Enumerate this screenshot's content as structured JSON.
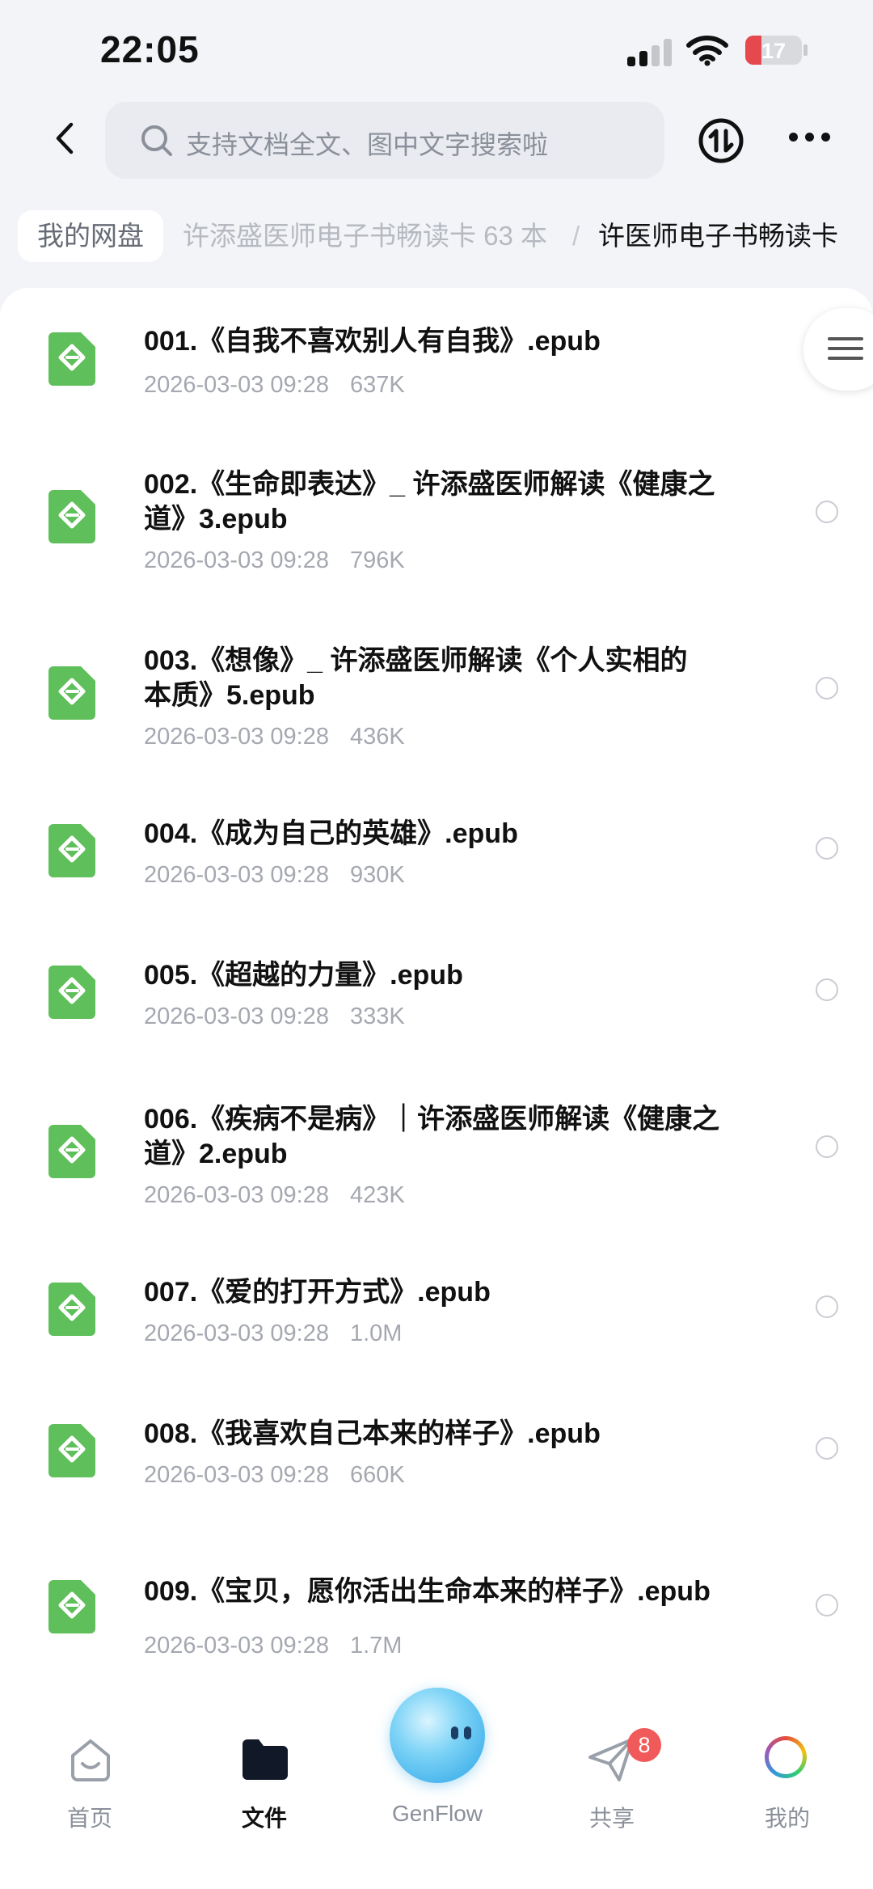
{
  "status_bar": {
    "time": "22:05",
    "battery": "17"
  },
  "search": {
    "placeholder": "支持文档全文、图中文字搜索啦"
  },
  "breadcrumb": {
    "home": "我的网盘",
    "middle": "许添盛医师电子书畅读卡 63 本",
    "separator": "/",
    "current": "许医师电子书畅读卡"
  },
  "files": [
    {
      "line1": "001.《自我不喜欢别人有自我》.epub",
      "line2": "",
      "date": "2026-03-03 09:28",
      "size": "637K"
    },
    {
      "line1": "002.《生命即表达》_ 许添盛医师解读《健康之",
      "line2": "道》3.epub",
      "date": "2026-03-03 09:28",
      "size": "796K"
    },
    {
      "line1": "003.《想像》_ 许添盛医师解读《个人实相的",
      "line2": "本质》5.epub",
      "date": "2026-03-03 09:28",
      "size": "436K"
    },
    {
      "line1": "004.《成为自己的英雄》.epub",
      "line2": "",
      "date": "2026-03-03 09:28",
      "size": "930K"
    },
    {
      "line1": "005.《超越的力量》.epub",
      "line2": "",
      "date": "2026-03-03 09:28",
      "size": "333K"
    },
    {
      "line1": "006.《疾病不是病》｜许添盛医师解读《健康之",
      "line2": "道》2.epub",
      "date": "2026-03-03 09:28",
      "size": "423K"
    },
    {
      "line1": "007.《爱的打开方式》.epub",
      "line2": "",
      "date": "2026-03-03 09:28",
      "size": "1.0M"
    },
    {
      "line1": "008.《我喜欢自己本来的样子》.epub",
      "line2": "",
      "date": "2026-03-03 09:28",
      "size": "660K"
    },
    {
      "line1": "009.《宝贝，愿你活出生命本来的样子》.epub",
      "line2": "",
      "date": "2026-03-03 09:28",
      "size": "1.7M"
    }
  ],
  "tabbar": {
    "home": "首页",
    "files": "文件",
    "genflow": "GenFlow",
    "share": "共享",
    "share_badge": "8",
    "mine": "我的"
  },
  "colors": {
    "epub_icon": "#5fbf5a",
    "badge": "#f05a5a",
    "accent": "#2aa3e6"
  }
}
